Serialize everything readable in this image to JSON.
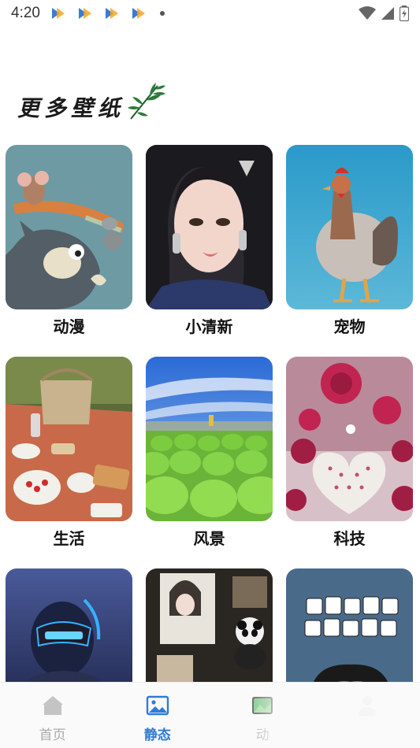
{
  "status_bar": {
    "time": "4:20",
    "notification_icons": [
      "app-notification-icon",
      "app-notification-icon",
      "app-notification-icon",
      "app-notification-icon"
    ],
    "right_icons": [
      "wifi-icon",
      "cellular-signal-icon",
      "battery-charging-icon"
    ]
  },
  "section": {
    "title": "更多壁纸",
    "decoration_icon": "bamboo-icon"
  },
  "categories": [
    {
      "label": "动漫",
      "image": "cartoon-cat-mouse-image"
    },
    {
      "label": "小清新",
      "image": "girl-portrait-image"
    },
    {
      "label": "宠物",
      "image": "rooster-image"
    },
    {
      "label": "生活",
      "image": "picnic-image"
    },
    {
      "label": "风景",
      "image": "green-field-landscape-image"
    },
    {
      "label": "科技",
      "image": "rose-heart-image"
    },
    {
      "label": "",
      "image": "cyber-warrior-image"
    },
    {
      "label": "",
      "image": "collage-panda-image"
    },
    {
      "label": "",
      "image": "cartoon-boy-quote-image"
    }
  ],
  "bottom_nav": {
    "items": [
      {
        "label": "首页",
        "icon": "home-icon",
        "active": false
      },
      {
        "label": "静态",
        "icon": "image-icon",
        "active": true
      },
      {
        "label": "动",
        "icon": "dynamic-wallpaper-icon",
        "active": false
      },
      {
        "label": "",
        "icon": "profile-icon",
        "active": false
      }
    ]
  },
  "colors": {
    "accent": "#2f7bd6",
    "inactive": "#aaaaaa",
    "background": "#ffffff"
  }
}
